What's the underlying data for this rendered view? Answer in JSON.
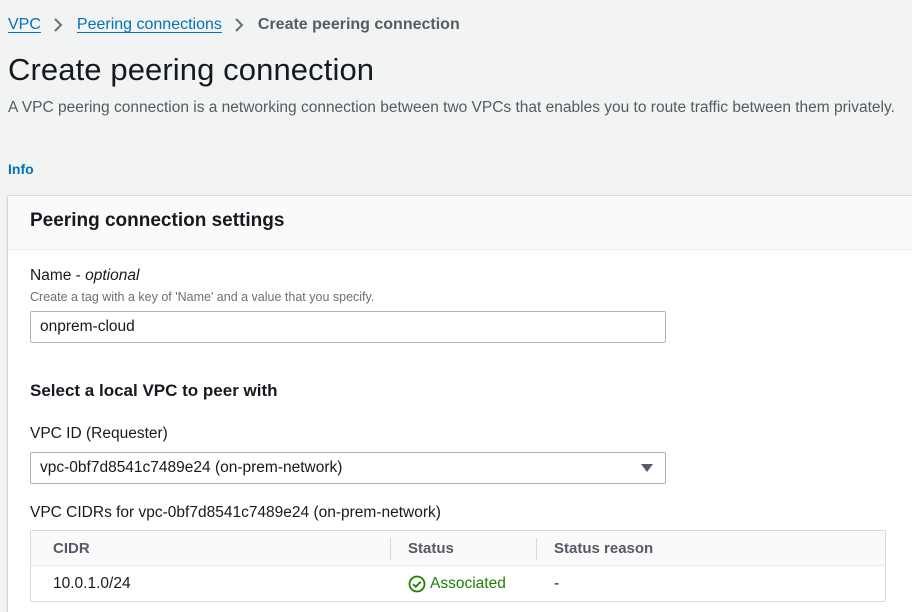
{
  "breadcrumb": {
    "items": [
      "VPC",
      "Peering connections"
    ],
    "current": "Create peering connection"
  },
  "page": {
    "title": "Create peering connection",
    "description": "A VPC peering connection is a networking connection between two VPCs that enables you to route traffic between them privately.",
    "info_link": "Info"
  },
  "settings": {
    "title": "Peering connection settings",
    "name_label": "Name - ",
    "name_optional": "optional",
    "name_hint": "Create a tag with a key of 'Name' and a value that you specify.",
    "name_value": "onprem-cloud",
    "local_vpc_heading": "Select a local VPC to peer with",
    "vpc_id_label": "VPC ID (Requester)",
    "vpc_id_value": "vpc-0bf7d8541c7489e24 (on-prem-network)",
    "cidrs_label": "VPC CIDRs for vpc-0bf7d8541c7489e24 (on-prem-network)",
    "table": {
      "headers": [
        "CIDR",
        "Status",
        "Status reason"
      ],
      "rows": [
        {
          "cidr": "10.0.1.0/24",
          "status": "Associated",
          "reason": "-"
        }
      ]
    }
  },
  "colors": {
    "link": "#0073bb",
    "success": "#1d8102",
    "background": "#f2f3f3"
  },
  "icons": {
    "breadcrumb_separator": "chevron-right-icon",
    "select_caret": "caret-down-icon",
    "status": "check-circle-icon"
  }
}
